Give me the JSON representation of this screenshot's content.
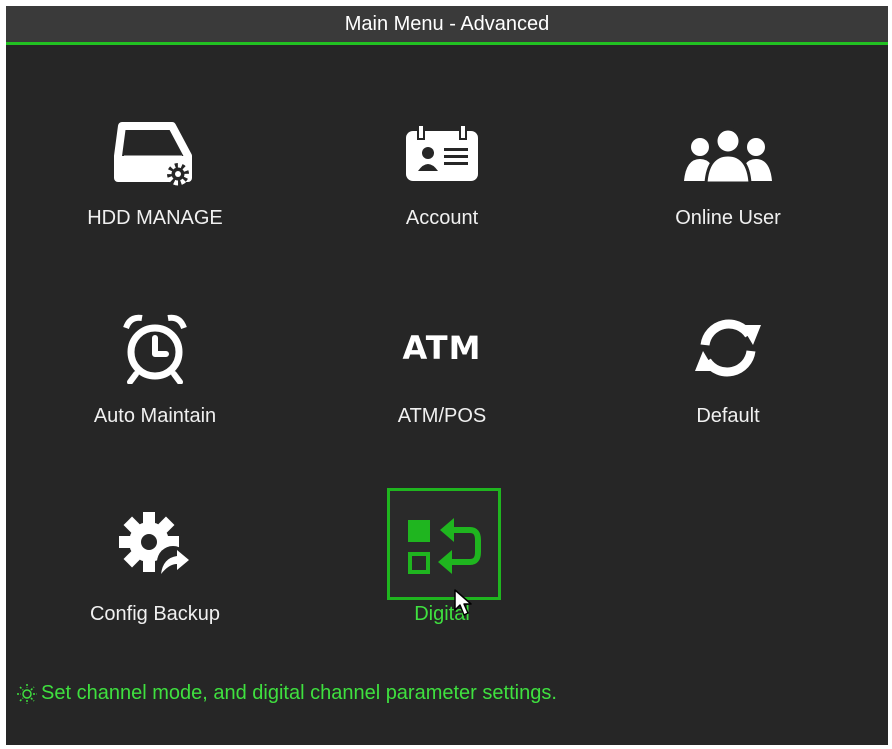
{
  "window": {
    "title": "Main Menu - Advanced",
    "accent_color": "#22c122",
    "selected_color": "#3fe03f"
  },
  "menu": {
    "items": [
      {
        "label": "HDD MANAGE",
        "icon": "hdd-manage-icon"
      },
      {
        "label": "Account",
        "icon": "account-card-icon"
      },
      {
        "label": "Online User",
        "icon": "online-users-icon"
      },
      {
        "label": "Auto Maintain",
        "icon": "alarm-clock-icon"
      },
      {
        "label": "ATM/POS",
        "icon_text": "ATM",
        "icon": "atm-icon"
      },
      {
        "label": "Default",
        "icon": "refresh-icon"
      },
      {
        "label": "Config Backup",
        "icon": "config-backup-icon"
      },
      {
        "label": "Digital",
        "icon": "digital-channel-icon",
        "selected": true
      }
    ]
  },
  "status": {
    "hint": "Set channel mode, and digital channel parameter settings.",
    "icon": "sun-icon"
  }
}
